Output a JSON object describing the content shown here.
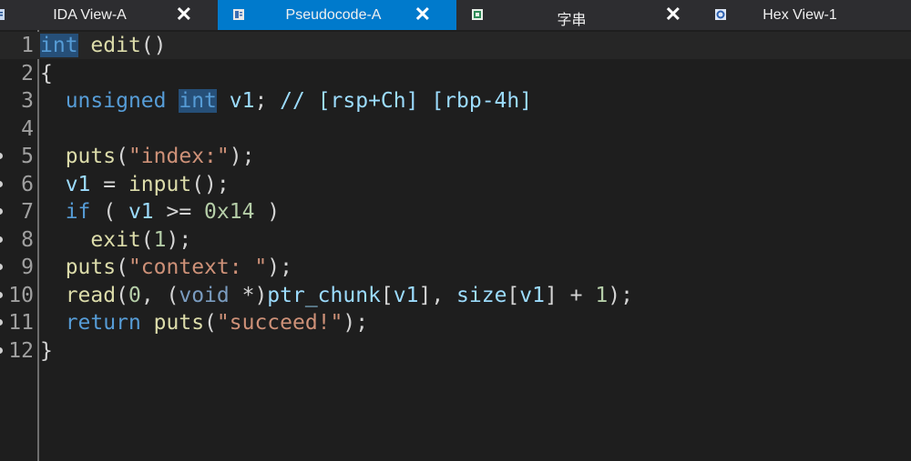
{
  "tabs": [
    {
      "id": "ida",
      "label": "IDA View-A",
      "icon": "disassembly-icon",
      "active": false,
      "close": "✕"
    },
    {
      "id": "pseudo",
      "label": "Pseudocode-A",
      "icon": "pseudocode-icon",
      "active": true,
      "close": "✕"
    },
    {
      "id": "strings",
      "label": "字串",
      "icon": "strings-icon",
      "active": false,
      "close": "✕"
    },
    {
      "id": "hex",
      "label": "Hex View-1",
      "icon": "hex-view-icon",
      "active": false
    }
  ],
  "colors": {
    "tab_active": "#007acc",
    "tab_bar": "#2d2d30",
    "editor_bg": "#1e1e1e",
    "keyword": "#569cd6",
    "variable": "#9cdcfe",
    "function": "#dcdcaa",
    "string": "#ce9178",
    "number": "#b5cea8",
    "selection": "#264f78"
  },
  "code": {
    "lines": [
      {
        "n": "1",
        "tokens": [
          [
            "kw hl",
            "int"
          ],
          [
            "plain",
            " "
          ],
          [
            "fn",
            "edit"
          ],
          [
            "punc",
            "()"
          ]
        ]
      },
      {
        "n": "2",
        "tokens": [
          [
            "punc",
            "{"
          ]
        ]
      },
      {
        "n": "3",
        "tokens": [
          [
            "plain",
            "  "
          ],
          [
            "kw",
            "unsigned"
          ],
          [
            "plain",
            " "
          ],
          [
            "kw hl",
            "int"
          ],
          [
            "plain",
            " "
          ],
          [
            "var",
            "v1"
          ],
          [
            "punc",
            "; "
          ],
          [
            "cmt",
            "// [rsp+Ch] [rbp-4h]"
          ]
        ]
      },
      {
        "n": "4",
        "tokens": []
      },
      {
        "n": "5",
        "bp": true,
        "tokens": [
          [
            "plain",
            "  "
          ],
          [
            "fn",
            "puts"
          ],
          [
            "punc",
            "("
          ],
          [
            "str",
            "\"index:\""
          ],
          [
            "punc",
            ");"
          ]
        ]
      },
      {
        "n": "6",
        "bp": true,
        "tokens": [
          [
            "plain",
            "  "
          ],
          [
            "var",
            "v1"
          ],
          [
            "punc",
            " = "
          ],
          [
            "fn",
            "input"
          ],
          [
            "punc",
            "();"
          ]
        ]
      },
      {
        "n": "7",
        "bp": true,
        "tokens": [
          [
            "plain",
            "  "
          ],
          [
            "kw",
            "if"
          ],
          [
            "punc",
            " ( "
          ],
          [
            "var",
            "v1"
          ],
          [
            "punc",
            " >= "
          ],
          [
            "num",
            "0x14"
          ],
          [
            "punc",
            " )"
          ]
        ]
      },
      {
        "n": "8",
        "bp": true,
        "tokens": [
          [
            "plain",
            "    "
          ],
          [
            "fn",
            "exit"
          ],
          [
            "punc",
            "("
          ],
          [
            "num",
            "1"
          ],
          [
            "punc",
            ");"
          ]
        ]
      },
      {
        "n": "9",
        "bp": true,
        "tokens": [
          [
            "plain",
            "  "
          ],
          [
            "fn",
            "puts"
          ],
          [
            "punc",
            "("
          ],
          [
            "str",
            "\"context: \""
          ],
          [
            "punc",
            ");"
          ]
        ]
      },
      {
        "n": "10",
        "bp": true,
        "tokens": [
          [
            "plain",
            "  "
          ],
          [
            "fn",
            "read"
          ],
          [
            "punc",
            "("
          ],
          [
            "num",
            "0"
          ],
          [
            "punc",
            ", ("
          ],
          [
            "kw-dim",
            "void"
          ],
          [
            "punc",
            " *)"
          ],
          [
            "var",
            "ptr_chunk"
          ],
          [
            "punc",
            "["
          ],
          [
            "var",
            "v1"
          ],
          [
            "punc",
            "], "
          ],
          [
            "var",
            "size"
          ],
          [
            "punc",
            "["
          ],
          [
            "var",
            "v1"
          ],
          [
            "punc",
            "] + "
          ],
          [
            "num",
            "1"
          ],
          [
            "punc",
            ");"
          ]
        ]
      },
      {
        "n": "11",
        "bp": true,
        "tokens": [
          [
            "plain",
            "  "
          ],
          [
            "kw",
            "return"
          ],
          [
            "plain",
            " "
          ],
          [
            "fn",
            "puts"
          ],
          [
            "punc",
            "("
          ],
          [
            "str",
            "\"succeed!\""
          ],
          [
            "punc",
            ");"
          ]
        ]
      },
      {
        "n": "12",
        "bp": true,
        "tokens": [
          [
            "punc",
            "}"
          ]
        ]
      }
    ]
  }
}
